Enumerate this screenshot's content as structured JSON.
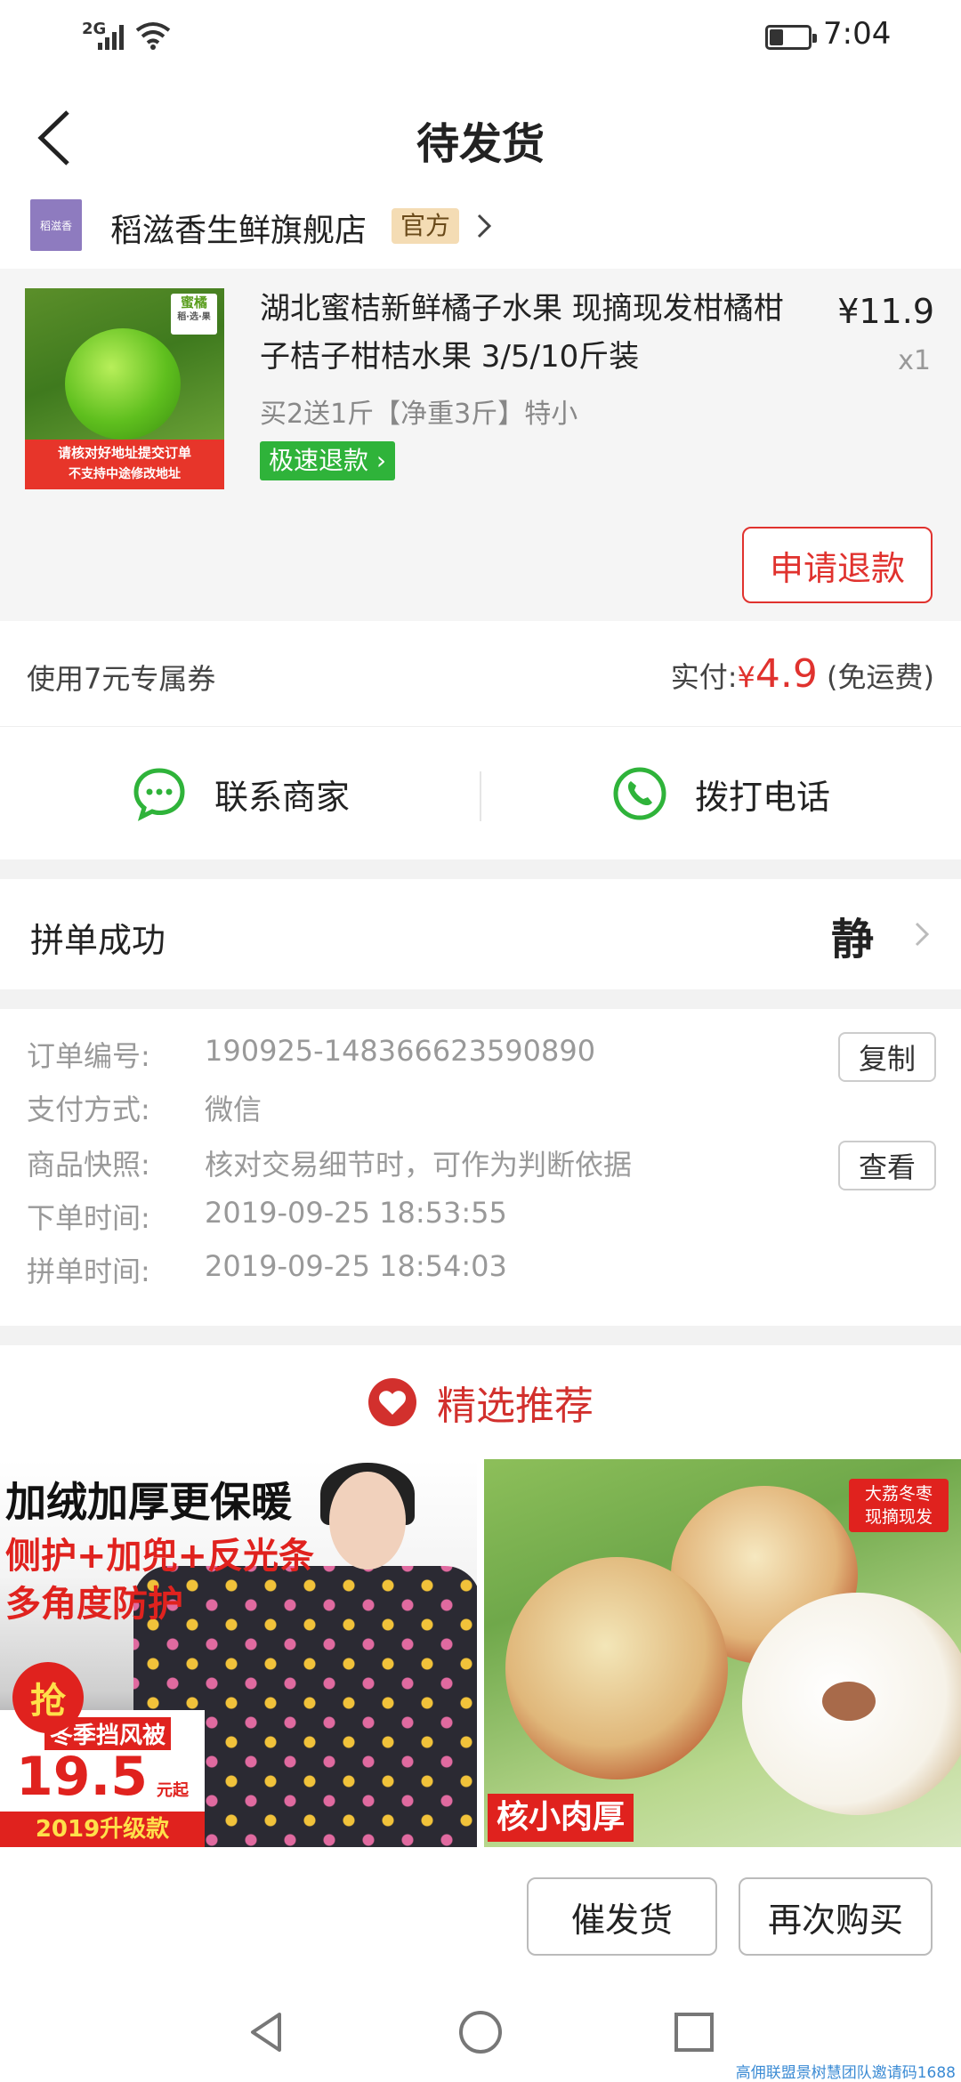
{
  "status_bar": {
    "network": "2G",
    "time": "7:04",
    "battery_level": 0.35,
    "icons": [
      "signal-icon",
      "wifi-icon",
      "battery-icon"
    ]
  },
  "header": {
    "title": "待发货",
    "back_icon": "back-icon"
  },
  "store": {
    "logo_text": "稻滋香",
    "name": "稻滋香生鲜旗舰店",
    "badge": "官方"
  },
  "product": {
    "title": "湖北蜜桔新鲜橘子水果 现摘现发柑橘柑子桔子柑桔水果 3/5/10斤装",
    "spec": "买2送1斤【净重3斤】特小",
    "refund_tag": "极速退款",
    "price": "¥11.9",
    "quantity": "x1",
    "thumb_tag_line1": "蜜橘",
    "thumb_tag_line2": "稻·选·果",
    "thumb_banner_line1": "请核对好地址提交订单",
    "thumb_banner_line2": "不支持中途修改地址",
    "apply_refund_label": "申请退款"
  },
  "payment": {
    "coupon": "使用7元专属券",
    "paid_label": "实付:",
    "currency": "¥",
    "amount": "4.9",
    "shipping_note": "(免运费)"
  },
  "contact": {
    "merchant_label": "联系商家",
    "call_label": "拨打电话"
  },
  "group": {
    "label": "拼单成功",
    "avatar_char": "静"
  },
  "order_info": {
    "rows": [
      {
        "key": "订单编号:",
        "value": "190925-148366623590890"
      },
      {
        "key": "支付方式:",
        "value": "微信"
      },
      {
        "key": "商品快照:",
        "value": "核对交易细节时，可作为判断依据"
      },
      {
        "key": "下单时间:",
        "value": "2019-09-25 18:53:55"
      },
      {
        "key": "拼单时间:",
        "value": "2019-09-25 18:54:03"
      }
    ],
    "copy_label": "复制",
    "view_label": "查看"
  },
  "recommend": {
    "title": "精选推荐",
    "left": {
      "line1": "加绒加厚更保暖",
      "line2": "侧护+加兜+反光条",
      "line3": "多角度防护",
      "badge": "抢",
      "promo_top": "冬季挡风被",
      "promo_price": "19.5",
      "promo_unit": "元起",
      "promo_bottom": "2019升级款"
    },
    "right": {
      "tag_line1": "大荔冬枣",
      "tag_line2": "现摘现发",
      "label": "核小肉厚"
    }
  },
  "actions": {
    "remind_label": "催发货",
    "rebuy_label": "再次购买"
  },
  "watermark": "高佣联盟景树慧团队邀请码1688"
}
